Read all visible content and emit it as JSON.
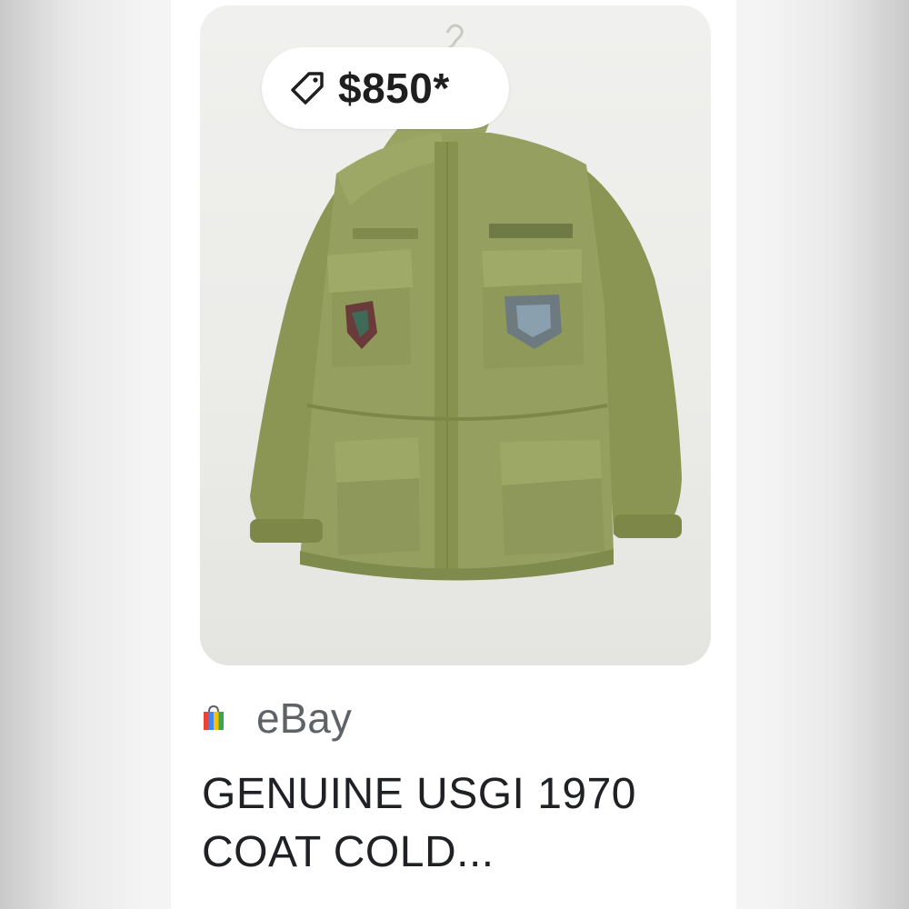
{
  "listing": {
    "price": "$850*",
    "price_icon": "price-tag-icon",
    "source_icon": "shopping-bag-icon",
    "source": "eBay",
    "title": "GENUINE USGI 1970 COAT COLD...",
    "image_subject": "olive green field jacket",
    "colors": {
      "jacket": "#8e9a5a",
      "text_primary": "#202124",
      "text_secondary": "#5f6368",
      "card_background": "#ffffff"
    }
  }
}
